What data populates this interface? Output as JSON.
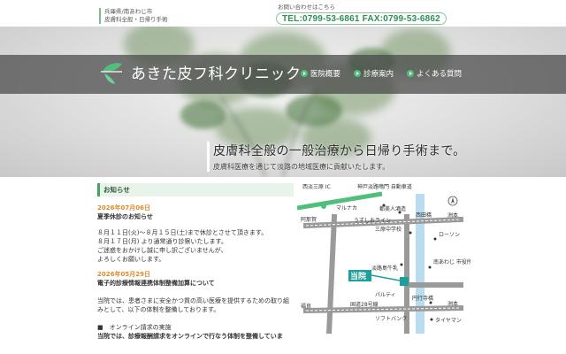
{
  "header": {
    "region_lines": [
      "兵庫県/南あわじ市",
      "皮膚科全般・日帰り手術"
    ],
    "contact_label": "お問い合わせはこちら",
    "contact_phones": "TEL:0799-53-6861 FAX:0799-53-6862"
  },
  "logo": {
    "text": "あきた皮フ科クリニック"
  },
  "nav": {
    "items": [
      {
        "label": "医院概要"
      },
      {
        "label": "診療案内"
      },
      {
        "label": "よくある質問"
      }
    ]
  },
  "hero": {
    "tagline_main": "皮膚科全般の一般治療から日帰り手術まで。",
    "tagline_sub": "皮膚科医療を通じて淡路の地域医療に貢献いたします。"
  },
  "news": {
    "heading": "お知らせ",
    "items": [
      {
        "date": "2026年07月06日",
        "title": "夏季休診のお知らせ",
        "body": [
          "８月１１日(火)～８月１５日(土)まで休診とさせて頂きます。",
          "８月１７日(月) より通常通り診察いたします。",
          "ご迷惑をおかけし誠に申し訳ございませんが、",
          "よろしくお願いします。"
        ]
      },
      {
        "date": "2026年05月29日",
        "title": "電子的診療情報連携体制整備加算について",
        "body": [
          "当院では、患者さまに安全かつ質の高い医療を提供するための取り組",
          "みとして、以下の体制を整備しております。"
        ]
      }
    ],
    "bullet": "■　オンライン請求の実施",
    "last_line": "当院では、診療報酬請求をオンラインで行なう体制を整備していま"
  },
  "map": {
    "labels": {
      "nishi_awaji_ic": "西淡三原\nIC",
      "kobe_awaji_bus": "神戸淡路鳴門\n自動車道",
      "marunaka": "マルナカ",
      "toshi_bijin": "都美人酒造",
      "nishida_bashi": "西田橋",
      "uzushio_line": "うずしおライン",
      "ama_sen": "阿那賀",
      "sumoto1": "洲本",
      "sanbara_jh": "三原中学校",
      "lawson": "ローソン",
      "awaji_milk": "淡路島牛乳",
      "minami_awaji": "南あわじ\n市役所",
      "toin": "当院",
      "paltie": "パルティ",
      "enkoji": "円行寺橋",
      "fukura": "福良",
      "route28": "国道28号線",
      "sumoto2": "洲本",
      "softbank": "ソフトバンク",
      "tireman": "タイヤマン"
    }
  },
  "colors": {
    "accent_green": "#3fa65f",
    "phone_green": "#2f8d57",
    "date_orange": "#e08a2a",
    "nav_band": "#464646"
  }
}
